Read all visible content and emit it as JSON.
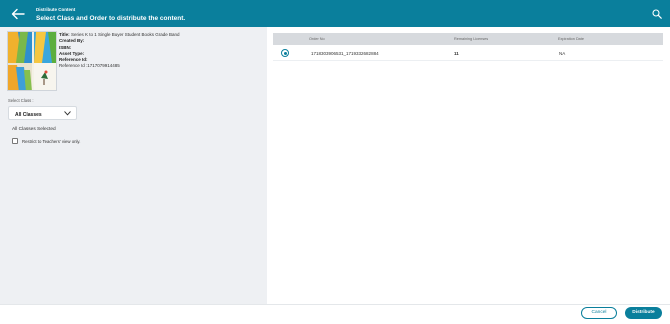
{
  "header": {
    "subtitle": "Distribute Content",
    "title": "Select Class and Order to distribute the content."
  },
  "book": {
    "title_label": "Title:",
    "title_value": "Series K to 1 Single Buyer Student Books Grade Band",
    "created_by_label": "Created By:",
    "isbn_label": "ISBN:",
    "asset_type_label": "Asset Type:",
    "reference_id_label": "Reference Id:",
    "reference_id_text": "Reference Id :1717079914485"
  },
  "class_select": {
    "label": "Select Class :",
    "value": "All Classes",
    "status": "All Classes Selected"
  },
  "restrict": {
    "label": "Restrict to Teachers' view only.",
    "checked": false
  },
  "table": {
    "columns": [
      "Order No",
      "Remaining Licenses",
      "Expiration Date"
    ],
    "rows": [
      {
        "order_no": "1718303906531_1719332682884",
        "remaining": "11",
        "expiration": "NA",
        "selected": true
      }
    ]
  },
  "footer": {
    "cancel_label": "Cancel",
    "distribute_label": "Distribute"
  },
  "colors": {
    "primary": "#0a7f9c",
    "panel": "#eef0f3",
    "table_header": "#d7dade"
  },
  "icons": {
    "back": "arrow-left-icon",
    "search": "search-icon",
    "dropdown": "chevron-down-icon"
  }
}
